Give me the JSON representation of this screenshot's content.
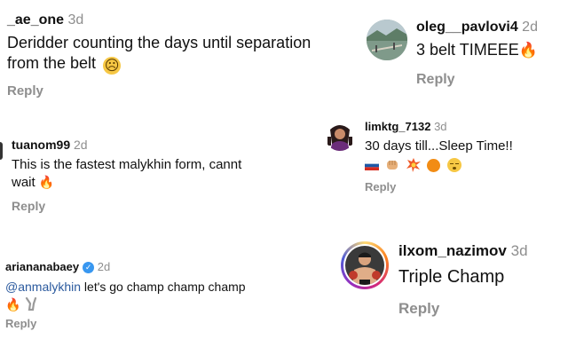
{
  "comments": [
    {
      "username": "_ae_one",
      "time": "3d",
      "lines": [
        "Deridder counting the days until separation",
        "from the belt"
      ],
      "emoji": "☹",
      "reply": "Reply"
    },
    {
      "username": "oleg__pavlovi4",
      "time": "2d",
      "text": "3 belt TIMEEE",
      "emoji": "🔥",
      "reply": "Reply",
      "avatar_icon": "landscape-photo-icon"
    },
    {
      "username": "limktg_7132",
      "time": "3d",
      "text": "30 days till...Sleep Time!!",
      "emojis": [
        "russia-flag",
        "fist",
        "collision",
        "orange-circle",
        "sleepy-face"
      ],
      "reply": "Reply",
      "avatar_icon": "cartoon-avatar-icon"
    },
    {
      "username": "tuanom99",
      "time": "2d",
      "lines": [
        "This is the fastest malykhin form, cannt",
        "wait"
      ],
      "emoji": "🔥",
      "reply": "Reply"
    },
    {
      "username": "ariananabaey",
      "time": "2d",
      "verified": true,
      "mention": "@anmalykhin",
      "text": " let's go champ champ champ",
      "emojis": [
        "fire",
        "handshake"
      ],
      "reply": "Reply"
    },
    {
      "username": "ilxom_nazimov",
      "time": "3d",
      "text": "Triple Champ",
      "reply": "Reply",
      "avatar_icon": "fighter-photo-icon"
    }
  ],
  "colors": {
    "text": "#111111",
    "muted": "#8e8e8e",
    "mention": "#2b5a9e",
    "verified": "#3897f0",
    "story_ring": "#d62976"
  }
}
